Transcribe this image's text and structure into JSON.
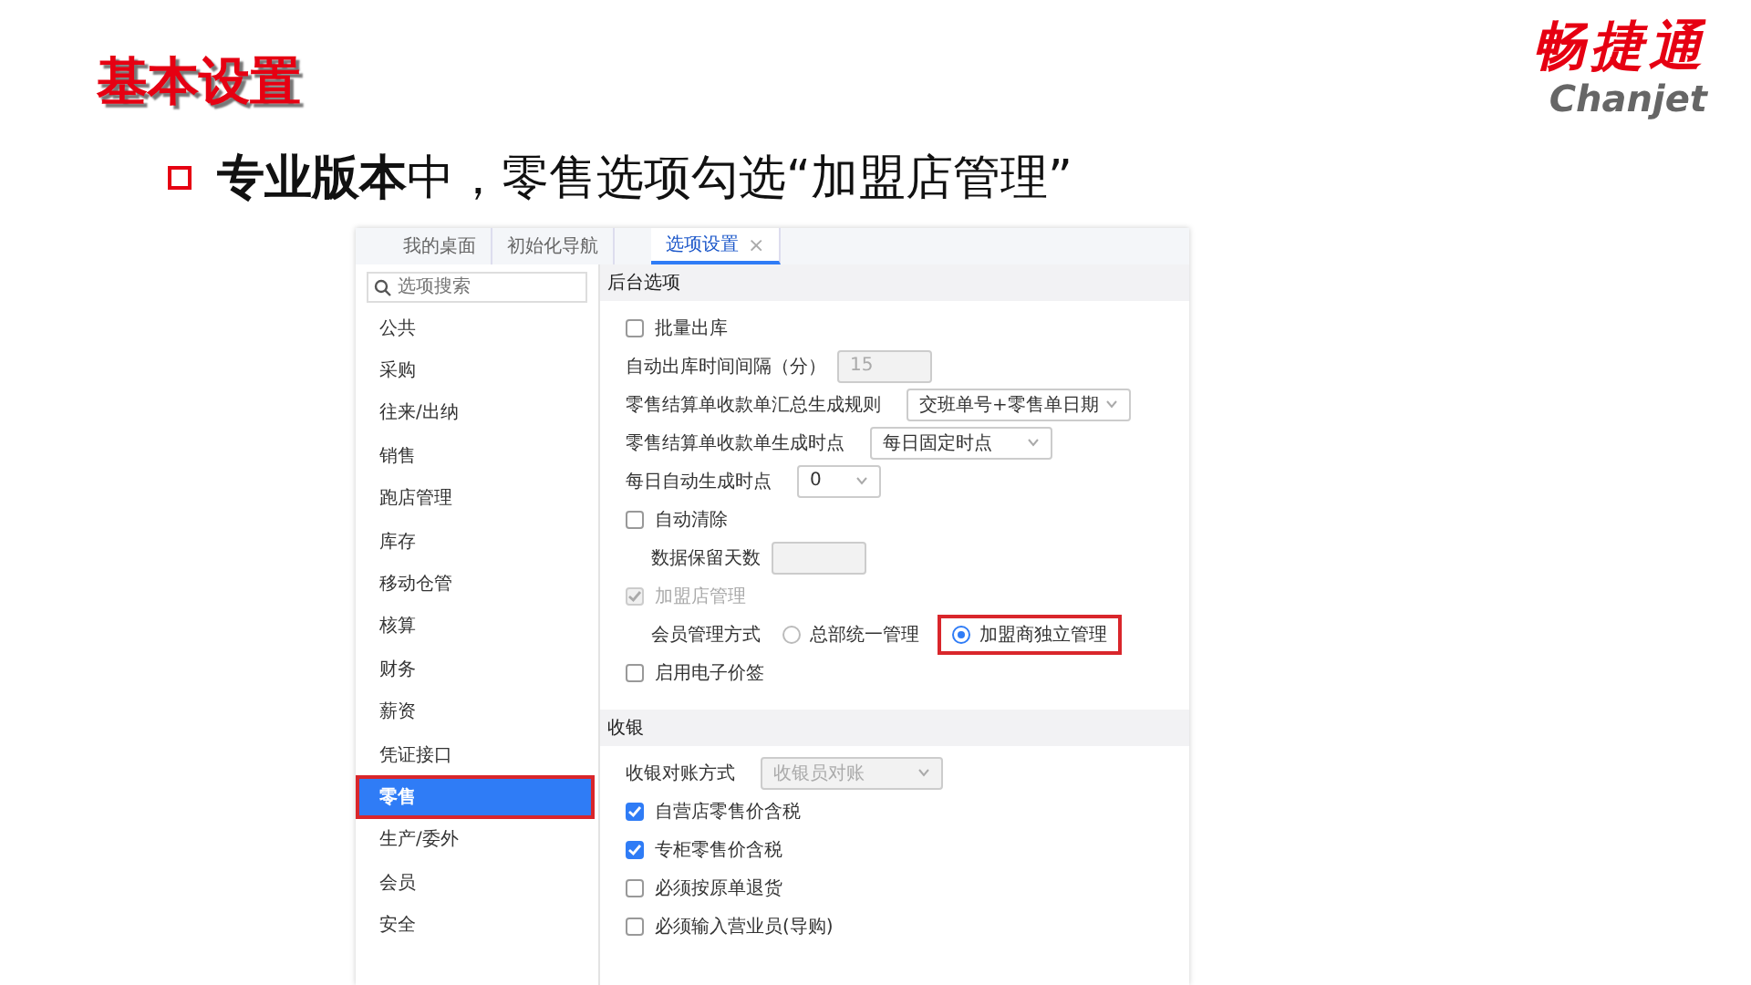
{
  "slide": {
    "title": "基本设置",
    "bullet": "**专业版本**中，零售选项勾选“加盟店管理”",
    "logo": {
      "name": "畅捷通",
      "latin": "Chanjet"
    }
  },
  "app": {
    "tabs": [
      {
        "label": "我的桌面",
        "selected": false
      },
      {
        "label": "初始化导航",
        "selected": false
      },
      {
        "label": "选项设置",
        "selected": true,
        "close": "×"
      }
    ],
    "search": {
      "placeholder": "选项搜索"
    },
    "sidebar": {
      "items": [
        {
          "label": "公共",
          "selected": false
        },
        {
          "label": "采购",
          "selected": false
        },
        {
          "label": "往来/出纳",
          "selected": false
        },
        {
          "label": "销售",
          "selected": false
        },
        {
          "label": "跑店管理",
          "selected": false
        },
        {
          "label": "库存",
          "selected": false
        },
        {
          "label": "移动仓管",
          "selected": false
        },
        {
          "label": "核算",
          "selected": false
        },
        {
          "label": "财务",
          "selected": false
        },
        {
          "label": "薪资",
          "selected": false
        },
        {
          "label": "凭证接口",
          "selected": false
        },
        {
          "label": "零售",
          "selected": true,
          "highlighted": true
        },
        {
          "label": "生产/委外",
          "selected": false
        },
        {
          "label": "会员",
          "selected": false
        },
        {
          "label": "安全",
          "selected": false
        }
      ]
    },
    "sections": [
      {
        "title": "后台选项",
        "rows": [
          {
            "kind": "checkbox",
            "label": "批量出库",
            "checked": false,
            "disabled": false
          },
          {
            "kind": "input",
            "label": "自动出库时间间隔（分）",
            "value": "15",
            "disabled": true
          },
          {
            "kind": "select",
            "label": "零售结算单收款单汇总生成规则",
            "value": "交班单号+零售单日期",
            "disabled": false
          },
          {
            "kind": "select",
            "label": "零售结算单收款单生成时点",
            "value": "每日固定时点",
            "disabled": false
          },
          {
            "kind": "select",
            "label": "每日自动生成时点",
            "value": "0",
            "disabled": false
          },
          {
            "kind": "checkbox",
            "label": "自动清除",
            "checked": false,
            "disabled": false,
            "children": [
              {
                "kind": "input",
                "label": "数据保留天数",
                "disabled": true
              }
            ]
          },
          {
            "kind": "checkbox",
            "label": "加盟店管理",
            "checked": true,
            "disabled": true,
            "children": [
              {
                "kind": "radio",
                "label": "会员管理方式",
                "options": [
                  {
                    "label": "总部统一管理",
                    "selected": false,
                    "highlighted": false
                  },
                  {
                    "label": "加盟商独立管理",
                    "selected": true,
                    "highlighted": true
                  }
                ]
              }
            ]
          },
          {
            "kind": "checkbox",
            "label": "启用电子价签",
            "checked": false,
            "disabled": false
          }
        ]
      },
      {
        "title": "收银",
        "rows": [
          {
            "kind": "select",
            "label": "收银对账方式",
            "value": "收银员对账",
            "disabled": true
          },
          {
            "kind": "checkbox",
            "label": "自营店零售价含税",
            "checked": true,
            "disabled": false
          },
          {
            "kind": "checkbox",
            "label": "专柜零售价含税",
            "checked": true,
            "disabled": false
          },
          {
            "kind": "checkbox",
            "label": "必须按原单退货",
            "checked": false,
            "disabled": false
          },
          {
            "kind": "checkbox",
            "label": "必须输入营业员(导购)",
            "checked": false,
            "disabled": false
          }
        ]
      }
    ]
  }
}
